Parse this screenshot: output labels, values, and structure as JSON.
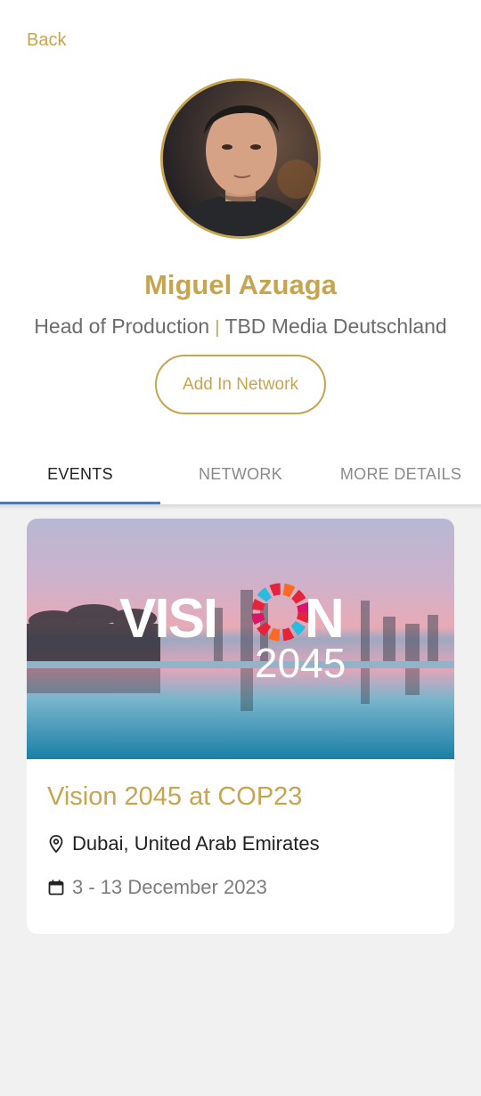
{
  "nav": {
    "back_label": "Back"
  },
  "profile": {
    "name": "Miguel Azuaga",
    "role": "Head of Production",
    "separator": "|",
    "company": "TBD Media Deutschland",
    "add_network_label": "Add In Network"
  },
  "tabs": [
    {
      "label": "EVENTS",
      "active": true
    },
    {
      "label": "NETWORK",
      "active": false
    },
    {
      "label": "MORE DETAILS",
      "active": false
    }
  ],
  "events": [
    {
      "banner_word": "VISION",
      "banner_year": "2045",
      "title": "Vision 2045 at COP23",
      "location_icon": "map-pin-icon",
      "location": "Dubai, United Arab Emirates",
      "date_icon": "calendar-icon",
      "dates": "3 - 13 December 2023"
    }
  ],
  "colors": {
    "accent": "#c9a44e",
    "tab_indicator": "#2f7fe0",
    "background": "#f1f1f1"
  }
}
